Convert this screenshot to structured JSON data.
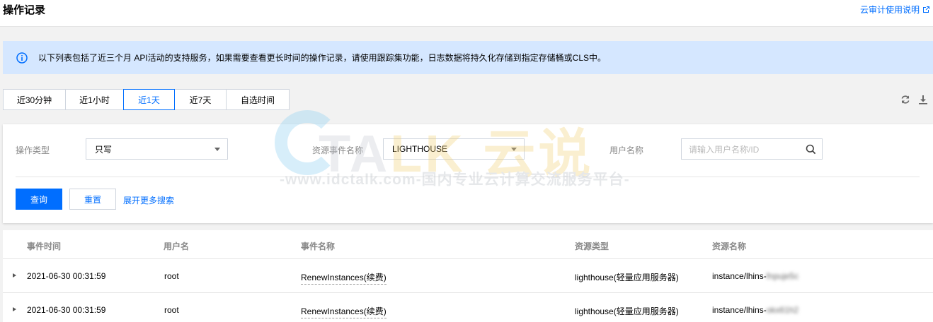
{
  "header": {
    "title": "操作记录",
    "doc_link": "云审计使用说明"
  },
  "notice": {
    "text": "以下列表包括了近三个月 API活动的支持服务，如果需要查看更长时间的操作记录，请使用跟踪集功能，日志数据将持久化存储到指定存储桶或CLS中。"
  },
  "time_range": {
    "options": [
      "近30分钟",
      "近1小时",
      "近1天",
      "近7天",
      "自选时间"
    ],
    "selected": "近1天"
  },
  "filters": {
    "op_type_label": "操作类型",
    "op_type_value": "只写",
    "event_label": "资源事件名称",
    "event_value": "LIGHTHOUSE",
    "user_label": "用户名称",
    "user_placeholder": "请输入用户名称/ID",
    "query_btn": "查询",
    "reset_btn": "重置",
    "more_link": "展开更多搜索"
  },
  "table": {
    "columns": [
      "事件时间",
      "用户名",
      "事件名称",
      "资源类型",
      "资源名称"
    ],
    "rows": [
      {
        "time": "2021-06-30 00:31:59",
        "user": "root",
        "event": "RenewInstances(续费)",
        "resource_type": "lighthouse(轻量应用服务器)",
        "resource_prefix": "instance/lhins-",
        "resource_masked": "fnpuje5c"
      },
      {
        "time": "2021-06-30 00:31:59",
        "user": "root",
        "event": "RenewInstances(续费)",
        "resource_type": "lighthouse(轻量应用服务器)",
        "resource_prefix": "instance/lhins-",
        "resource_masked": "okx61h2"
      }
    ]
  },
  "watermark": {
    "logo_a": "TA",
    "logo_b": "LK 云说",
    "sub": "-www.idctalk.com-国内专业云计算交流服务平台-"
  },
  "colors": {
    "accent": "#006eff",
    "notice_bg": "#d5e7ff"
  },
  "icons": [
    "external-link-icon",
    "info-icon",
    "refresh-icon",
    "download-icon",
    "search-icon",
    "expand-arrow-icon",
    "chevron-down-icon"
  ]
}
